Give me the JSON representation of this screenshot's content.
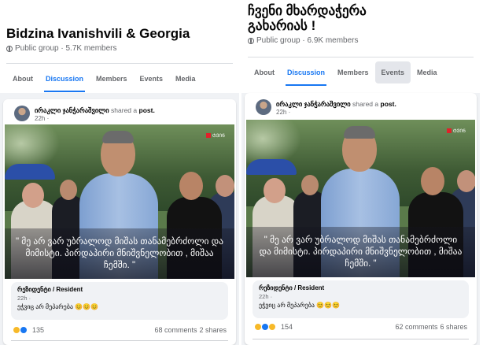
{
  "left": {
    "group_name": "Bidzina Ivanishvili & Georgia",
    "group_meta": "Public group · 5.7K members",
    "tabs": [
      "About",
      "Discussion",
      "Members",
      "Events",
      "Media"
    ],
    "post": {
      "author": "ირაკლი ჯანჭარაშვილი",
      "action": "shared a",
      "object": "post.",
      "time": "22h ·",
      "photo_logo": "ᲢᲕᲘᲜ",
      "quote": "\" მე არ ვარ უბრალოდ მიშას თანამებრძოლი და მიმისტი. პირდაპირი მნიშვნელობით , მიშაა ჩემში. \"",
      "comment": {
        "name": "რეზიდენტი / Resident",
        "time": "22h ·",
        "text": "ეჭვიც არ მეპარება 😊😊😊"
      },
      "reaction_count": "135",
      "comments": "68 comments",
      "shares": "2 shares"
    }
  },
  "right": {
    "group_name": "ჩვენი მხარდაჭერა გახარიას !",
    "group_meta": "Public group · 6.9K members",
    "tabs": [
      "About",
      "Discussion",
      "Members",
      "Events",
      "Media"
    ],
    "post": {
      "author": "ირაკლი ჯანჭარაშვილი",
      "action": "shared a",
      "object": "post.",
      "time": "22h ·",
      "photo_logo": "ᲢᲕᲘᲜ",
      "quote": "\" მე არ ვარ უბრალოდ მიშას თანამებრძოლი და მიმისტი. პირდაპირი მნიშვნელობით , მიშაა ჩემში. \"",
      "comment": {
        "name": "რეზიდენტი / Resident",
        "time": "22h ·",
        "text": "ეჭვიც არ მეპარება 😊😊😊"
      },
      "reaction_count": "154",
      "comments": "62 comments",
      "shares": "6 shares"
    }
  },
  "colors": {
    "accent": "#1877f2",
    "muted": "#65676b",
    "bg": "#f0f2f5"
  },
  "icons": [
    "globe-icon",
    "haha-reaction-icon",
    "like-reaction-icon",
    "wow-reaction-icon"
  ]
}
